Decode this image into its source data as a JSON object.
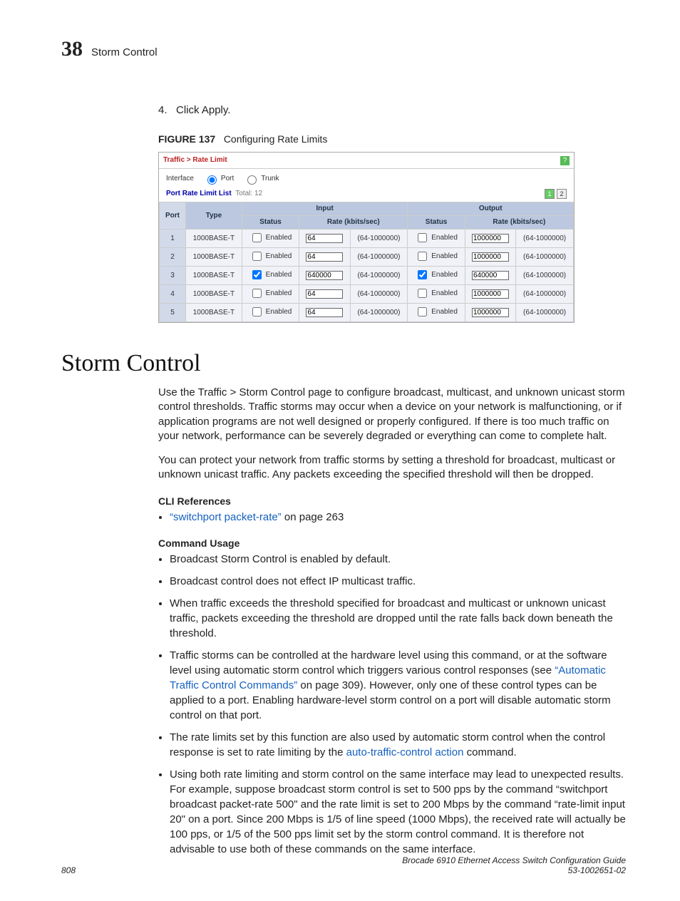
{
  "header": {
    "chapter_num": "38",
    "chapter_title": "Storm Control"
  },
  "step": {
    "num": "4.",
    "text": "Click Apply."
  },
  "figure": {
    "label": "FIGURE 137",
    "title": "Configuring Rate Limits",
    "breadcrumb": "Traffic > Rate Limit",
    "interface_label": "Interface",
    "opt_port": "Port",
    "opt_trunk": "Trunk",
    "list_title": "Port Rate Limit List",
    "total_label": "Total:",
    "total_value": "12",
    "page1": "1",
    "page2": "2",
    "th_port": "Port",
    "th_type": "Type",
    "th_input": "Input",
    "th_output": "Output",
    "th_status": "Status",
    "th_rate": "Rate (kbits/sec)",
    "enabled_lbl": "Enabled",
    "range": "(64-1000000)",
    "rows": [
      {
        "port": "1",
        "type": "1000BASE-T",
        "in_chk": false,
        "in_rate": "64",
        "out_chk": false,
        "out_rate": "1000000"
      },
      {
        "port": "2",
        "type": "1000BASE-T",
        "in_chk": false,
        "in_rate": "64",
        "out_chk": false,
        "out_rate": "1000000"
      },
      {
        "port": "3",
        "type": "1000BASE-T",
        "in_chk": true,
        "in_rate": "640000",
        "out_chk": true,
        "out_rate": "640000"
      },
      {
        "port": "4",
        "type": "1000BASE-T",
        "in_chk": false,
        "in_rate": "64",
        "out_chk": false,
        "out_rate": "1000000"
      },
      {
        "port": "5",
        "type": "1000BASE-T",
        "in_chk": false,
        "in_rate": "64",
        "out_chk": false,
        "out_rate": "1000000"
      }
    ]
  },
  "section": {
    "heading": "Storm Control",
    "p1": "Use the Traffic > Storm Control page to configure broadcast, multicast, and unknown unicast storm control thresholds. Traffic storms may occur when a device on your network is malfunctioning, or if application programs are not well designed or properly configured. If there is too much traffic on your network, performance can be severely degraded or everything can come to complete halt.",
    "p2": "You can protect your network from traffic storms by setting a threshold for broadcast, multicast or unknown unicast traffic. Any packets exceeding the specified threshold will then be dropped.",
    "cli_h": "CLI References",
    "cli_link": "“switchport packet-rate”",
    "cli_suffix": " on page 263",
    "usage_h": "Command Usage",
    "u1": "Broadcast Storm Control is enabled by default.",
    "u2": "Broadcast control does not effect IP multicast traffic.",
    "u3": "When traffic exceeds the threshold specified for broadcast and multicast or unknown unicast traffic, packets exceeding the threshold are dropped until the rate falls back down beneath the threshold.",
    "u4a": "Traffic storms can be controlled at the hardware level using this command, or at the software level using automatic storm control which triggers various control responses (see ",
    "u4link": "“Automatic Traffic Control Commands”",
    "u4b": " on page 309). However, only one of these control types can be applied to a port. Enabling hardware-level storm control on a port will disable automatic storm control on that port.",
    "u5a": "The rate limits set by this function are also used by automatic storm control when the control response is set to rate limiting by the ",
    "u5link": "auto-traffic-control action",
    "u5b": " command.",
    "u6": "Using both rate limiting and storm control on the same interface may lead to unexpected results. For example, suppose broadcast storm control is set to 500 pps by the command “switchport broadcast packet-rate 500\" and the rate limit is set to 200 Mbps by the command “rate-limit input 20\" on a port. Since 200 Mbps is 1/5 of line speed (1000 Mbps), the received rate will actually be 100 pps, or 1/5 of the 500 pps limit set by the storm control command. It is therefore not advisable to use both of these commands on the same interface."
  },
  "footer": {
    "page": "808",
    "line1": "Brocade 6910 Ethernet Access Switch Configuration Guide",
    "line2": "53-1002651-02"
  }
}
